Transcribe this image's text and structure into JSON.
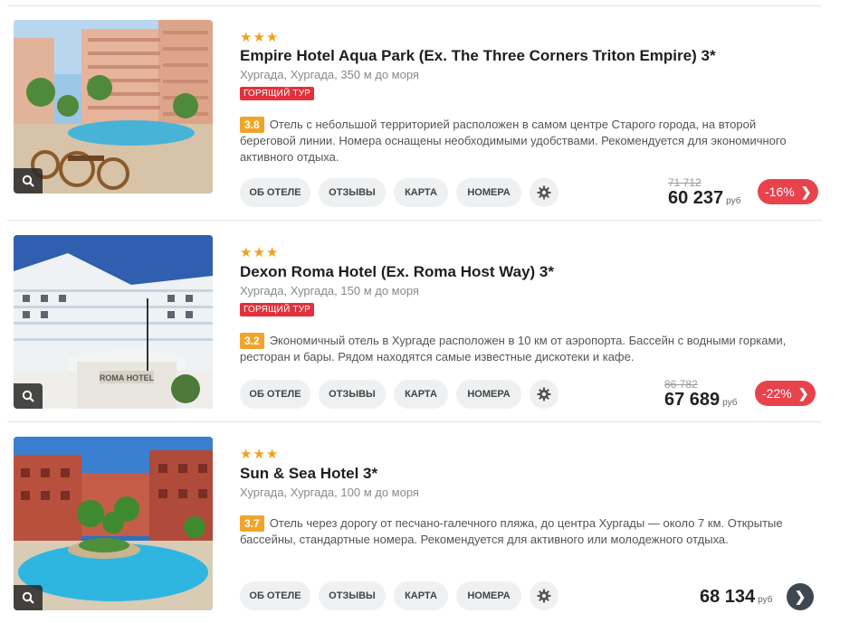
{
  "hotels": [
    {
      "stars": "★★★",
      "name": "Empire Hotel Aqua Park (Ex. The Three Corners Triton Empire) 3*",
      "location": "Хургада, Хургада, 350 м до моря",
      "hot_badge": "ГОРЯЩИЙ ТУР",
      "rating": "3.8",
      "description": "Отель с небольшой территорией расположен в самом центре Старого города, на второй береговой линии. Номера оснащены необходимыми удобствами. Рекомендуется для экономичного активного отдыха.",
      "buttons": {
        "about": "ОБ ОТЕЛЕ",
        "reviews": "ОТЗЫВЫ",
        "map": "КАРТА",
        "rooms": "НОМЕРА"
      },
      "old_price": "71 712",
      "price": "60 237",
      "currency": "руб",
      "discount": "-16%"
    },
    {
      "stars": "★★★",
      "name": "Dexon Roma Hotel (Ex. Roma Host Way) 3*",
      "location": "Хургада, Хургада, 150 м до моря",
      "hot_badge": "ГОРЯЩИЙ ТУР",
      "rating": "3.2",
      "description": "Экономичный отель в Хургаде расположен в 10 км от аэропорта. Бассейн с водными горками, ресторан и бары. Рядом находятся самые известные дискотеки и кафе.",
      "buttons": {
        "about": "ОБ ОТЕЛЕ",
        "reviews": "ОТЗЫВЫ",
        "map": "КАРТА",
        "rooms": "НОМЕРА"
      },
      "old_price": "86 782",
      "price": "67 689",
      "currency": "руб",
      "discount": "-22%"
    },
    {
      "stars": "★★★",
      "name": "Sun & Sea Hotel 3*",
      "location": "Хургада, Хургада, 100 м до моря",
      "rating": "3.7",
      "description": "Отель через дорогу от песчано-галечного пляжа, до центра Хургады — около 7 км. Открытые бассейны, стандартные номера. Рекомендуется для активного или молодежного отдыха.",
      "buttons": {
        "about": "ОБ ОТЕЛЕ",
        "reviews": "ОТЗЫВЫ",
        "map": "КАРТА",
        "rooms": "НОМЕРА"
      },
      "price": "68 134",
      "currency": "руб"
    }
  ],
  "icons": {
    "zoom": "magnifier-icon",
    "settings": "gear-icon",
    "arrow": "chevron-right-icon"
  },
  "colors": {
    "hot": "#e2313b",
    "rating": "#f0a52a",
    "discount": "#e8434d",
    "stars": "#f0a020"
  }
}
